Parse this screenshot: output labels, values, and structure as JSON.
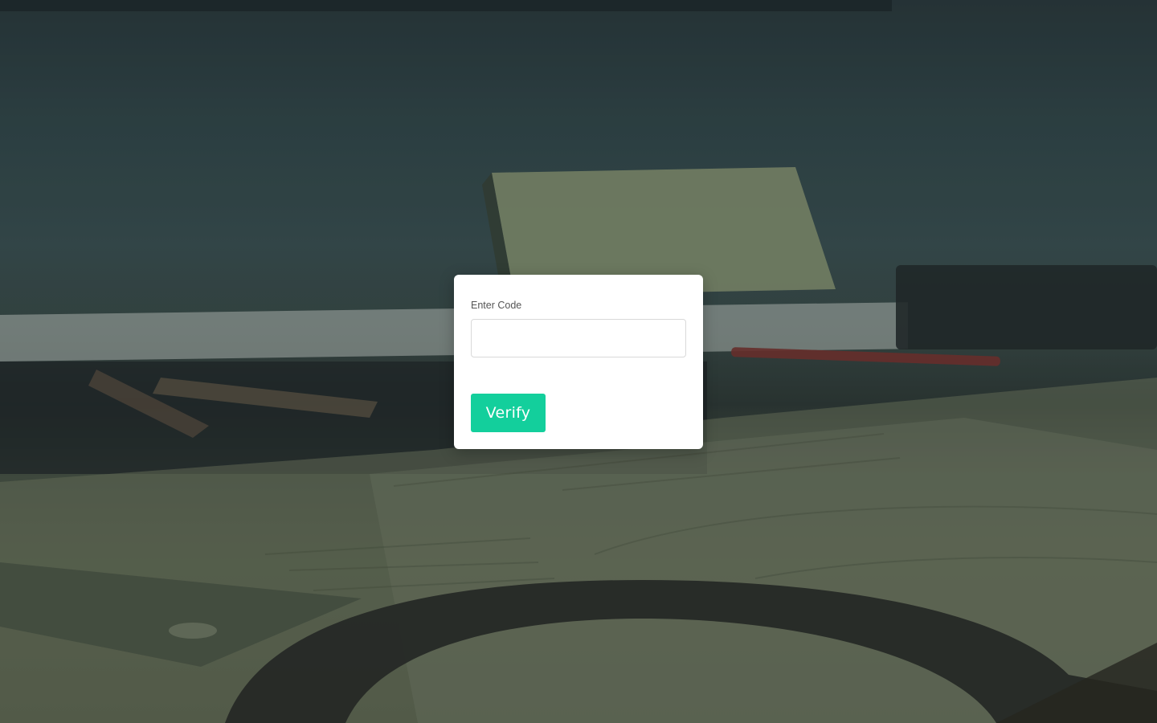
{
  "form": {
    "code_label": "Enter Code",
    "code_value": "",
    "code_placeholder": "",
    "verify_label": "Verify"
  },
  "colors": {
    "accent": "#13cf9c",
    "card_background": "#ffffff"
  }
}
